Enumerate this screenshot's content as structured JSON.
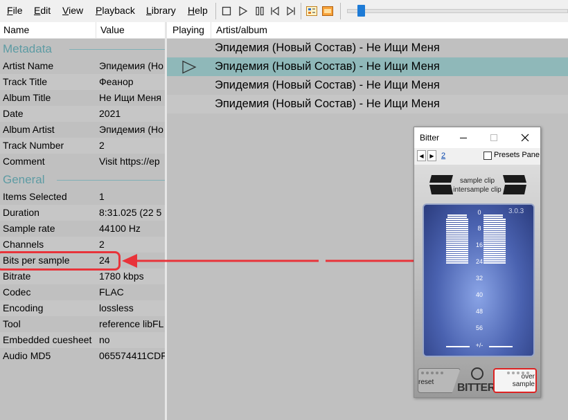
{
  "menu": {
    "items": [
      "File",
      "Edit",
      "View",
      "Playback",
      "Library",
      "Help"
    ],
    "underline": [
      "F",
      "E",
      "V",
      "P",
      "L",
      "H"
    ],
    "rest": [
      "ile",
      "dit",
      "iew",
      "layback",
      "ibrary",
      "elp"
    ]
  },
  "toolbar": {
    "icons": [
      "stop-icon",
      "play-icon",
      "pause-icon",
      "previous-icon",
      "next-icon",
      "random-icon",
      "view-icon"
    ]
  },
  "seekbar": {
    "position": 0.05
  },
  "columns": {
    "name": "Name",
    "value": "Value",
    "playing": "Playing",
    "artist_album": "Artist/album"
  },
  "properties": {
    "metadata_title": "Metadata",
    "metadata": [
      {
        "name": "Artist Name",
        "value": "Эпидемия (Но"
      },
      {
        "name": "Track Title",
        "value": "Феанор"
      },
      {
        "name": "Album Title",
        "value": "Не Ищи Меня"
      },
      {
        "name": "Date",
        "value": "2021"
      },
      {
        "name": "Album Artist",
        "value": "Эпидемия (Но"
      },
      {
        "name": "Track Number",
        "value": "2"
      },
      {
        "name": "Comment",
        "value": "Visit https://ep"
      }
    ],
    "general_title": "General",
    "general": [
      {
        "name": "Items Selected",
        "value": "1"
      },
      {
        "name": "Duration",
        "value": "8:31.025 (22 5"
      },
      {
        "name": "Sample rate",
        "value": "44100 Hz"
      },
      {
        "name": "Channels",
        "value": "2"
      },
      {
        "name": "Bits per sample",
        "value": "24"
      },
      {
        "name": "Bitrate",
        "value": "1780 kbps"
      },
      {
        "name": "Codec",
        "value": "FLAC"
      },
      {
        "name": "Encoding",
        "value": "lossless"
      },
      {
        "name": "Tool",
        "value": "reference libFL"
      },
      {
        "name": "Embedded cuesheet",
        "value": "no"
      },
      {
        "name": "Audio MD5",
        "value": "065574411CDF"
      }
    ]
  },
  "playlist": [
    {
      "text": "Эпидемия (Новый Состав) - Не Ищи Меня",
      "playing": false
    },
    {
      "text": "Эпидемия (Новый Состав) - Не Ищи Меня",
      "playing": true
    },
    {
      "text": "Эпидемия (Новый Состав) - Не Ищи Меня",
      "playing": false
    },
    {
      "text": "Эпидемия (Новый Состав) - Не Ищи Меня",
      "playing": false
    }
  ],
  "bitter": {
    "title": "Bitter",
    "preset_link": "2",
    "presets_pane": "Presets Pane",
    "sample_clip": "sample clip",
    "intersample_clip": "intersample clip",
    "version": "3.0.3",
    "scale": [
      "0",
      "8",
      "16",
      "24",
      "32",
      "40",
      "48",
      "56",
      "+/-"
    ],
    "bits_lit": 24,
    "reset": "reset",
    "logo": "BITTER",
    "over": "over",
    "sample": "sample"
  },
  "colors": {
    "accent": "#5d9ba3",
    "selection": "#8fb8b9",
    "annotation": "#e8333a",
    "seek_thumb": "#1e7bd6"
  }
}
